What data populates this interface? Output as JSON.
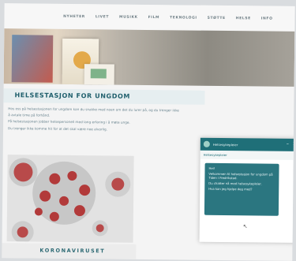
{
  "nav": {
    "items": [
      "NYHETER",
      "LIVET",
      "MUSIKK",
      "FILM",
      "TEKNOLOGI",
      "STØTTE",
      "HELSE",
      "INFO"
    ]
  },
  "page": {
    "title": "HELSESTASJON FOR UNGDOM",
    "paragraph1": "Hos oss på helsestasjonen for ungdom kan du snakke med noen om det du lurer på, og du trenger ikke å avtale time på forhånd.",
    "paragraph2": "På helsestasjonen jobber helsepersonell med lang erfaring i å møte unge.",
    "paragraph3": "Du trenger ikke komme hit for at det skal være noe alvorlig."
  },
  "article": {
    "label": "KORONAVIRUSET"
  },
  "chat": {
    "header_name": "Helsesykepleier",
    "subheader": "Helsesykepleier",
    "greeting": "Hei!",
    "line1": "Velkommen til helsestasjon for ungdom på Tiden i Fredrikstad.",
    "line2": "Du chatter nå med helsesykepleier.",
    "line3": "Hva kan jeg hjelpe deg med?",
    "minimize": "–",
    "close": "×"
  },
  "colors": {
    "accent": "#1f6f78",
    "title": "#1f5f6c"
  }
}
